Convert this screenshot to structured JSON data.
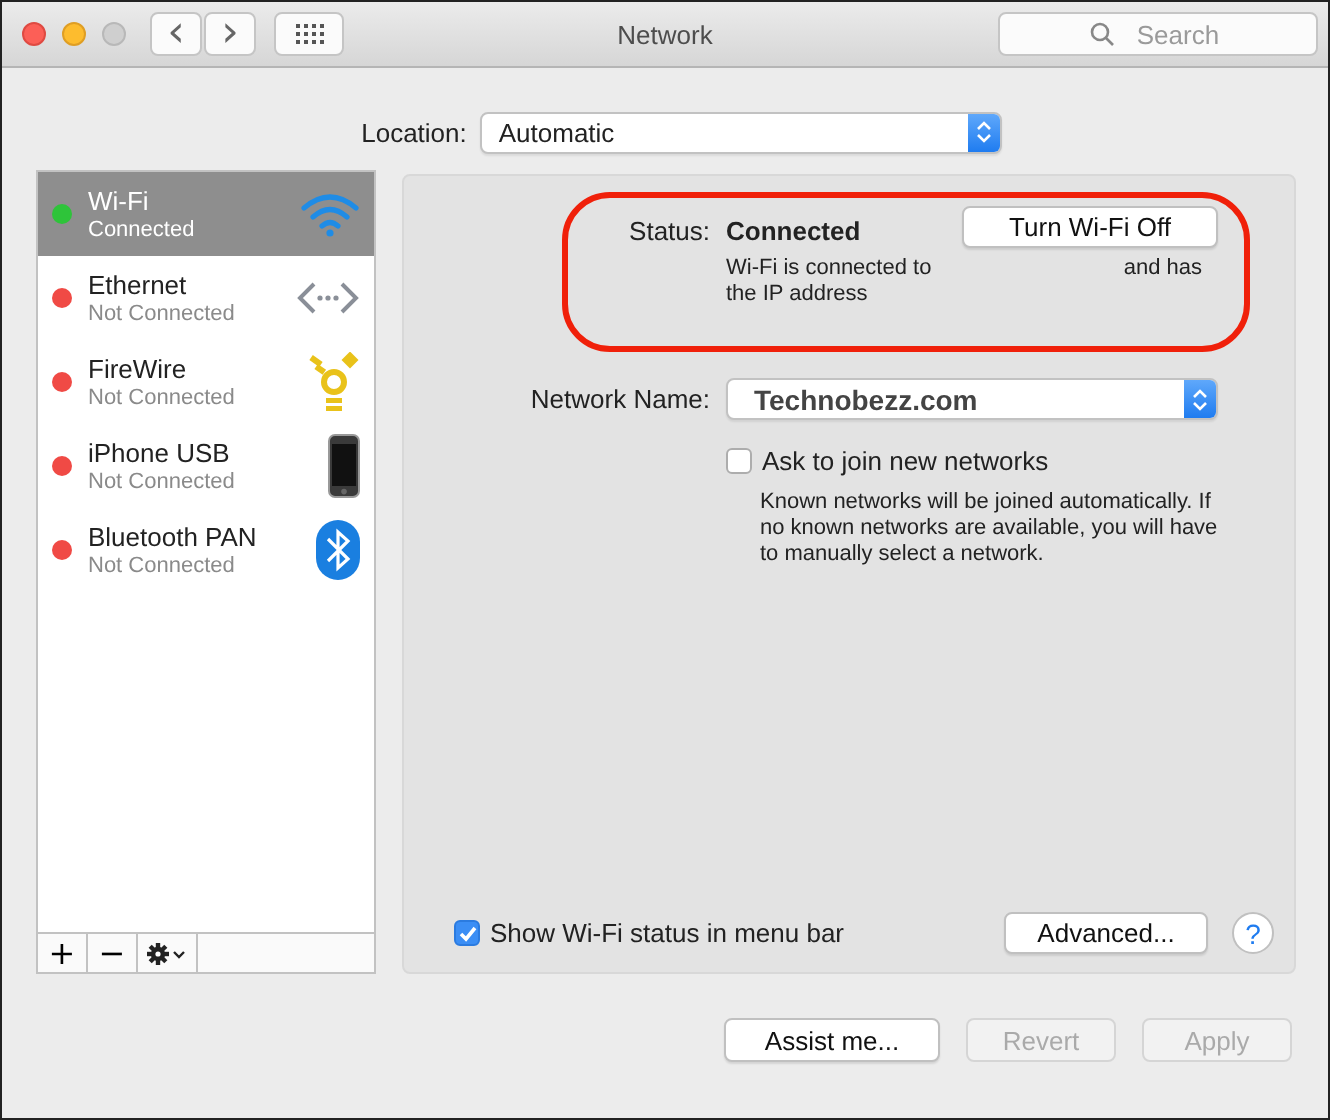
{
  "window": {
    "title": "Network",
    "search_placeholder": "Search",
    "back": "‹",
    "forward": "›"
  },
  "location": {
    "label": "Location:",
    "value": "Automatic"
  },
  "services": [
    {
      "name": "Wi-Fi",
      "status": "Connected",
      "color": "#2ec43a",
      "selected": true,
      "kind": "wifi"
    },
    {
      "name": "Ethernet",
      "status": "Not Connected",
      "color": "#f04a45",
      "selected": false,
      "kind": "ethernet"
    },
    {
      "name": "FireWire",
      "status": "Not Connected",
      "color": "#f04a45",
      "selected": false,
      "kind": "firewire"
    },
    {
      "name": "iPhone USB",
      "status": "Not Connected",
      "color": "#f04a45",
      "selected": false,
      "kind": "iphone"
    },
    {
      "name": "Bluetooth PAN",
      "status": "Not Connected",
      "color": "#f04a45",
      "selected": false,
      "kind": "bluetooth"
    }
  ],
  "sidebar_footer": {
    "add": "+",
    "remove": "−"
  },
  "status": {
    "label": "Status:",
    "value": "Connected",
    "button": "Turn Wi-Fi Off",
    "detail_left": "Wi-Fi is connected to",
    "detail_right": "and has",
    "detail_line2": "the IP address"
  },
  "network_name": {
    "label": "Network Name:",
    "value": "Technobezz.com"
  },
  "ask_to_join": {
    "label": "Ask to join new networks",
    "checked": false,
    "help": "Known networks will be joined automatically. If no known networks are available, you will have to manually select a network."
  },
  "show_status": {
    "label": "Show Wi-Fi status in menu bar",
    "checked": true
  },
  "advanced_button": "Advanced...",
  "help_button": "?",
  "buttons": [
    {
      "label": "Assist me...",
      "disabled": false
    },
    {
      "label": "Revert",
      "disabled": true
    },
    {
      "label": "Apply",
      "disabled": true
    }
  ]
}
